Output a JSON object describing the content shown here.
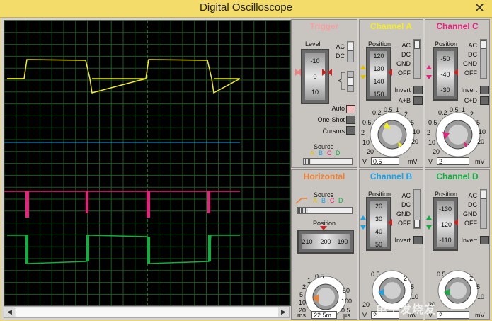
{
  "window": {
    "title": "Digital Oscilloscope",
    "close_label": "✕"
  },
  "trigger": {
    "title": "Trigger",
    "level_label": "Level",
    "level_ticks": [
      "-10",
      "0",
      "10"
    ],
    "ac_label": "AC",
    "dc_label": "DC",
    "auto_label": "Auto",
    "oneshot_label": "One-Shot",
    "cursors_label": "Cursors",
    "source_label": "Source",
    "source_letters": [
      "A",
      "B",
      "C",
      "D"
    ]
  },
  "horizontal": {
    "title": "Horizontal",
    "source_label": "Source",
    "source_letters": [
      "A",
      "B",
      "C",
      "D"
    ],
    "position_label": "Position",
    "position_ticks": [
      "210",
      "200",
      "190"
    ],
    "dial_scale": [
      "0.5",
      "1",
      "2",
      "5",
      "10",
      "20",
      "50",
      "100",
      "200",
      "0.5"
    ],
    "unit_left": "ms",
    "unit_right": "µs",
    "value": "22.5m"
  },
  "channels": {
    "a": {
      "title": "Channel A",
      "position_label": "Position",
      "ticks": [
        "120",
        "130",
        "140",
        "150"
      ],
      "options": [
        "AC",
        "DC",
        "GND",
        "OFF"
      ],
      "invert_label": "Invert",
      "combine_label": "A+B",
      "dial_scale": [
        "0.2",
        "0.5",
        "1",
        "2",
        "5",
        "10",
        "20",
        "20",
        "10",
        "5",
        "2",
        "0.5"
      ],
      "unit_left": "V",
      "unit_right": "mV",
      "value": "0.5"
    },
    "b": {
      "title": "Channel B",
      "position_label": "Position",
      "ticks": [
        "20",
        "30",
        "40",
        "50"
      ],
      "options": [
        "AC",
        "DC",
        "GND",
        "OFF"
      ],
      "invert_label": "Invert",
      "dial_scale": [
        "0.2",
        "0.5",
        "1",
        "2",
        "5",
        "10",
        "20"
      ],
      "unit_left": "V",
      "unit_right": "mV",
      "value": "2"
    },
    "c": {
      "title": "Channel C",
      "position_label": "Position",
      "ticks": [
        "-50",
        "-40",
        "-30"
      ],
      "options": [
        "AC",
        "DC",
        "GND",
        "OFF"
      ],
      "invert_label": "Invert",
      "combine_label": "C+D",
      "dial_scale": [
        "0.2",
        "0.5",
        "1",
        "2",
        "5",
        "10",
        "20",
        "20",
        "10",
        "5",
        "2",
        "0.5"
      ],
      "unit_left": "V",
      "unit_right": "mV",
      "value": "2"
    },
    "d": {
      "title": "Channel D",
      "position_label": "Position",
      "ticks": [
        "-130",
        "-120",
        "-110"
      ],
      "options": [
        "AC",
        "DC",
        "GND",
        "OFF"
      ],
      "invert_label": "Invert",
      "dial_scale": [
        "0.2",
        "0.5",
        "1",
        "2",
        "5",
        "10",
        "20"
      ],
      "unit_left": "V",
      "unit_right": "mV",
      "value": "2"
    }
  },
  "colors": {
    "channel_a": "#f5ee1a",
    "channel_b": "#1aa3e8",
    "channel_c": "#e8207e",
    "channel_d": "#10b040",
    "trigger": "#f08080",
    "horizontal": "#f08030",
    "grid": "#1f5a1f"
  },
  "watermark": "电子发烧友"
}
